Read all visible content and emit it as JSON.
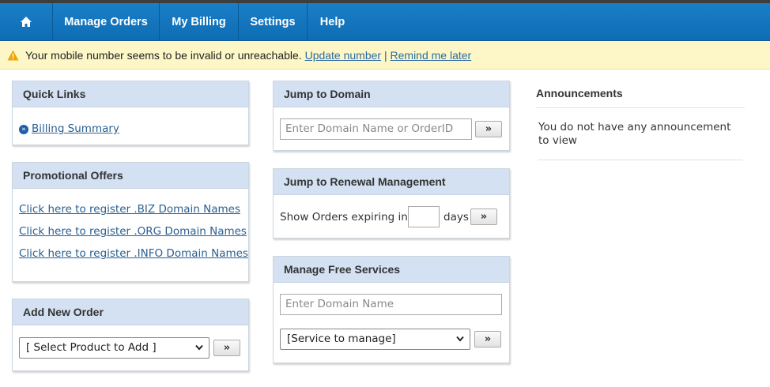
{
  "nav": {
    "home_icon": "home-icon",
    "items": [
      "Manage Orders",
      "My Billing",
      "Settings",
      "Help"
    ]
  },
  "alert": {
    "icon": "warning-icon",
    "message": "Your mobile number seems to be invalid or unreachable.",
    "update_link": "Update number",
    "separator": "|",
    "remind_link": "Remind me later"
  },
  "quick_links": {
    "title": "Quick Links",
    "items": [
      "Billing Summary"
    ]
  },
  "promotional_offers": {
    "title": "Promotional Offers",
    "items": [
      "Click here to register .BIZ Domain Names",
      "Click here to register .ORG Domain Names",
      "Click here to register .INFO Domain Names"
    ]
  },
  "add_new_order": {
    "title": "Add New Order",
    "select_value": "[ Select Product to Add ]",
    "go_label": "»"
  },
  "jump_to_domain": {
    "title": "Jump to Domain",
    "placeholder": "Enter Domain Name or OrderID",
    "go_label": "»"
  },
  "jump_to_renewal": {
    "title": "Jump to Renewal Management",
    "prefix": "Show Orders expiring in",
    "days_value": "",
    "suffix": "days",
    "go_label": "»"
  },
  "manage_free_services": {
    "title": "Manage Free Services",
    "placeholder": "Enter Domain Name",
    "select_value": "[Service to manage]",
    "go_label": "»"
  },
  "announcements": {
    "title": "Announcements",
    "text": "You do not have any announcement to view"
  },
  "colors": {
    "nav_bg": "#0e6cb4",
    "panel_header_bg": "#d3e1f2",
    "alert_bg": "#fdf7c8",
    "link": "#2a5f91"
  }
}
